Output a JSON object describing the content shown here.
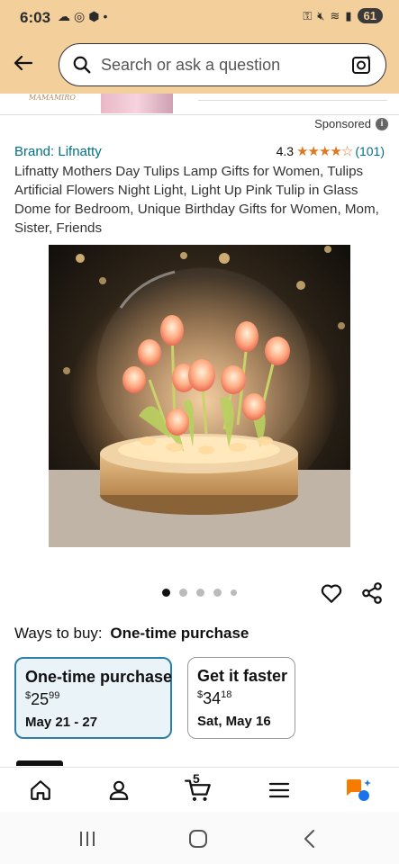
{
  "status_bar": {
    "time": "6:03",
    "battery": "61"
  },
  "search": {
    "placeholder": "Search or ask a question"
  },
  "ad": {
    "logo_text": "MAMAMIRO"
  },
  "sponsored_label": "Sponsored",
  "product": {
    "brand": "Brand: Lifnatty",
    "rating_value": "4.3",
    "rating_stars": "★★★★☆",
    "rating_stars_fraction": 0.86,
    "review_count": "(101)",
    "title": "Lifnatty Mothers Day Tulips Lamp Gifts for Women, Tulips Artificial Flowers Night Light, Light Up Pink Tulip in Glass Dome for Bedroom, Unique Birthday Gifts for Women, Mom, Sister, Friends",
    "image_alt": "Glowing pink tulips inside a glass dome on a wooden base"
  },
  "carousel": {
    "active_index": 0,
    "total_dots": 5
  },
  "ways_to_buy": {
    "label": "Ways to buy:",
    "selected": "One-time purchase"
  },
  "options": [
    {
      "title": "One-time purchase",
      "currency": "$",
      "price_whole": "25",
      "price_fraction": "99",
      "date": "May 21 - 27",
      "selected": true
    },
    {
      "title": "Get it faster",
      "currency": "$",
      "price_whole": "34",
      "price_fraction": "18",
      "date": "Sat, May 16",
      "selected": false
    }
  ],
  "bottom_nav": {
    "cart_count": "5",
    "items": [
      "home-icon",
      "account-icon",
      "cart-icon",
      "menu-icon",
      "rufus-icon"
    ]
  },
  "colors": {
    "header_bg": "#f3cf9c",
    "link": "#007185",
    "star": "#de7921",
    "selected_border": "#2e7fa8",
    "rufus_orange": "#f57c00",
    "rufus_blue": "#1a73e8"
  }
}
